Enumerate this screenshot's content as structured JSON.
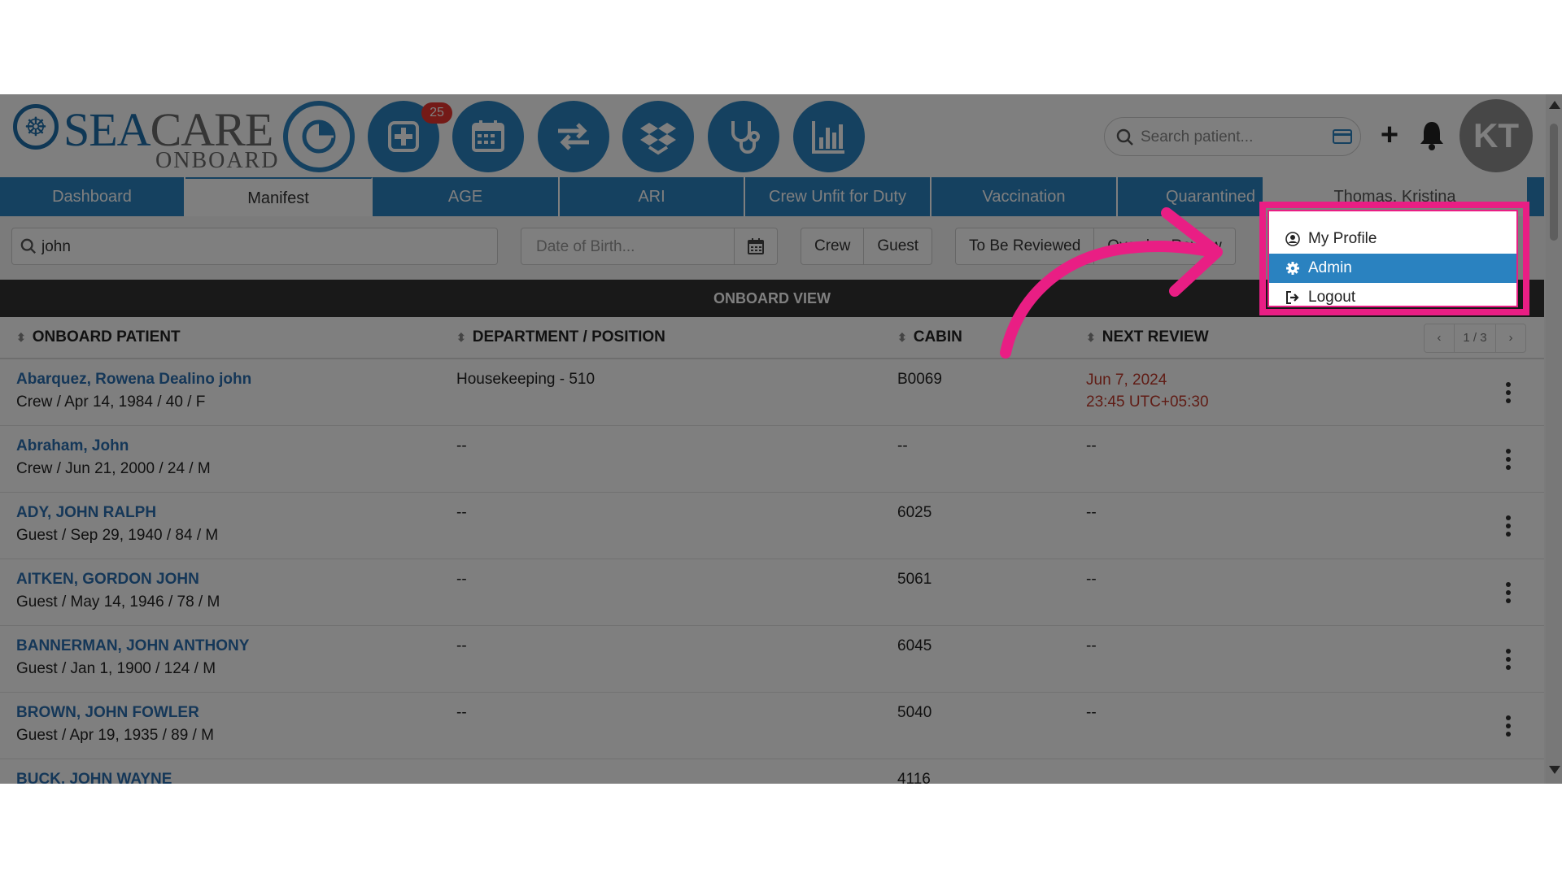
{
  "header": {
    "logo_main": "SEA",
    "logo_accent": "CARE",
    "logo_sub": "ONBOARD",
    "nav_icons": [
      "dashboard-pie-icon",
      "add-case-icon",
      "calendar-icon",
      "transfer-icon",
      "inventory-box-icon",
      "stethoscope-icon",
      "reports-chart-icon"
    ],
    "badge_count": "25",
    "search_placeholder": "Search patient...",
    "avatar_initials": "KT"
  },
  "tabs": [
    {
      "label": "Dashboard"
    },
    {
      "label": "Manifest"
    },
    {
      "label": "AGE"
    },
    {
      "label": "ARI"
    },
    {
      "label": "Crew Unfit for Duty"
    },
    {
      "label": "Vaccination"
    },
    {
      "label": "Quarantined"
    }
  ],
  "active_tab": "Manifest",
  "user_name": "Thomas, Kristina",
  "filters": {
    "search_value": "john",
    "dob_placeholder": "Date of Birth...",
    "type_buttons": [
      "Crew",
      "Guest"
    ],
    "review_buttons": [
      "To Be Reviewed",
      "Overdue Review"
    ]
  },
  "table": {
    "view_title": "ONBOARD VIEW",
    "columns": [
      "ONBOARD PATIENT",
      "DEPARTMENT / POSITION",
      "CABIN",
      "NEXT REVIEW"
    ],
    "pager": {
      "prev": "‹",
      "page": "1 / 3",
      "next": "›"
    },
    "rows": [
      {
        "name": "Abarquez, Rowena Dealino john",
        "details": "Crew / Apr 14, 1984 / 40 / F",
        "department": "Housekeeping - 510",
        "cabin": "B0069",
        "review_date": "Jun 7, 2024",
        "review_time": "23:45 UTC+05:30"
      },
      {
        "name": "Abraham, John",
        "details": "Crew / Jun 21, 2000 / 24 / M",
        "department": "--",
        "cabin": "--",
        "review_date": "--",
        "review_time": ""
      },
      {
        "name": "ADY, JOHN RALPH",
        "details": "Guest / Sep 29, 1940 / 84 / M",
        "department": "--",
        "cabin": "6025",
        "review_date": "--",
        "review_time": ""
      },
      {
        "name": "AITKEN, GORDON JOHN",
        "details": "Guest / May 14, 1946 / 78 / M",
        "department": "--",
        "cabin": "5061",
        "review_date": "--",
        "review_time": ""
      },
      {
        "name": "BANNERMAN, JOHN ANTHONY",
        "details": "Guest / Jan 1, 1900 / 124 / M",
        "department": "--",
        "cabin": "6045",
        "review_date": "--",
        "review_time": ""
      },
      {
        "name": "BROWN, JOHN FOWLER",
        "details": "Guest / Apr 19, 1935 / 89 / M",
        "department": "--",
        "cabin": "5040",
        "review_date": "--",
        "review_time": ""
      },
      {
        "name": "BUCK, JOHN WAYNE",
        "details": "",
        "department": "",
        "cabin": "4116",
        "review_date": "",
        "review_time": ""
      }
    ]
  },
  "user_menu": {
    "items": [
      {
        "label": "My Profile",
        "icon": "user-circle-icon"
      },
      {
        "label": "Admin",
        "icon": "gear-icon"
      },
      {
        "label": "Logout",
        "icon": "logout-icon"
      }
    ],
    "selected": "Admin"
  },
  "colors": {
    "brand_blue": "#2a82c0",
    "overdue_red": "#c0392b",
    "annotation_pink": "#e91e84"
  }
}
